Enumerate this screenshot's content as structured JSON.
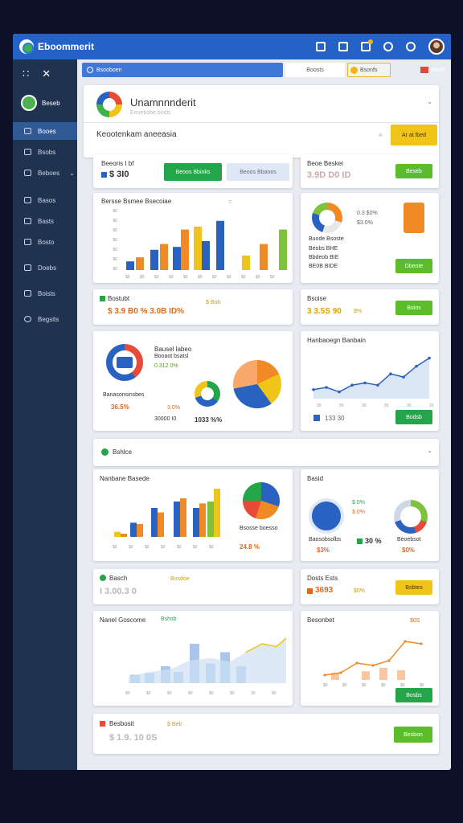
{
  "app": {
    "title": "Eboommerit"
  },
  "sidebar": {
    "user": "Beseb",
    "items": [
      {
        "label": "Booes"
      },
      {
        "label": "Bsobs"
      },
      {
        "label": "Beboes"
      },
      {
        "label": "Basos"
      },
      {
        "label": "Basts"
      },
      {
        "label": "Bosto"
      },
      {
        "label": "Doebs"
      },
      {
        "label": "Boists"
      },
      {
        "label": "Begsits"
      }
    ]
  },
  "search": {
    "placeholder": "Bsooboen",
    "btn1": "Boosts",
    "btn2": "Bsonfs",
    "read": "Banb"
  },
  "header": {
    "title": "Unamnnnderit",
    "subtitle": "Eeoebobe bodis",
    "section": "Keootenkam aneeasia",
    "action": "Ar at lbed"
  },
  "cards": {
    "c1": {
      "title": "Beeoris I bf",
      "value": "$ 3I0",
      "btn1": "Beoos Bbinks",
      "btn2": "Beoos Bbanos"
    },
    "c2": {
      "title": "Beoe Beskei",
      "value": "3.9D D0 ID",
      "btn": "Beseb"
    },
    "c3": {
      "title": "Bersse Bsmee Bsecoiae",
      "ticks": [
        "$0",
        "$0",
        "$0",
        "$0",
        "$0",
        "$0",
        "$0"
      ],
      "xl": [
        "$0",
        "$0",
        "$0",
        "$0",
        "$0",
        "$0",
        "$0",
        "$0",
        "$0",
        "$0",
        "$0"
      ]
    },
    "c4": {
      "legend": [
        "0.3 $0%",
        "$3.0%",
        "Buode Bsoste",
        "Beobs BHE",
        "Bbdeob BIE",
        "BE0B BIDE"
      ],
      "btn": "Dbeote"
    },
    "c5": {
      "title": "Bostubt",
      "value": "$ 3.9 B0 % 3.0B ID%",
      "tag": "$ Bob"
    },
    "c6": {
      "title": "Bsoise",
      "value": "3 3.5S 90",
      "tag": "$%",
      "btn": "Boios"
    },
    "c7": {
      "title": "Bausel labeo",
      "sub": "Booaot bsatsl",
      "pct": "0.312 0%",
      "cap": "Banasonsinsbes",
      "v1": "36.5%",
      "v2": "30000 I0",
      "v3": "1033 %%",
      "v4": "3.0%"
    },
    "c8": {
      "title": "Hanbaoegn Banbain",
      "value": "133 30",
      "btn": "Bodsb",
      "xl": [
        "30",
        "50",
        "30",
        "50",
        "30",
        "20"
      ]
    },
    "sec": {
      "title": "Bshlce"
    },
    "c9": {
      "title": "Nanbane Basede",
      "val": "24.8 %",
      "cap": "Bsosse boesso",
      "xl": [
        "$0",
        "$0",
        "$0",
        "$0",
        "$0",
        "$0",
        "$0"
      ]
    },
    "c10": {
      "title": "Basid",
      "b1": "$ 0%",
      "b2": "$ 0%",
      "v1": "$3%",
      "v2": "30 %",
      "v3": "$0%",
      "cap1": "Baosobsolbs",
      "cap2": "Beoebsot"
    },
    "c11": {
      "title": "Basch",
      "tag": "Bosdoe",
      "value": "I 3.00.3 0"
    },
    "c12": {
      "title": "Dosts Ests",
      "value": "3693",
      "tag": "$0%",
      "btn": "Bsbtes"
    },
    "c13": {
      "title": "Nanel Goscome",
      "tag": "Bshsb",
      "xl": [
        "$0",
        "$0",
        "$0",
        "$0",
        "$0",
        "$0",
        "30",
        "$0"
      ]
    },
    "c14": {
      "title": "Besonbet",
      "tag": "$0S",
      "xl": [
        "$0",
        "$0",
        "$0",
        "$0",
        "$0",
        "$0"
      ],
      "btn": "Bosbs"
    },
    "c15": {
      "title": "Besbosit",
      "value": "$ 1.9. 10 0S",
      "tag": "$ Beb",
      "btn": "Besbon"
    }
  },
  "colors": {
    "blue": "#2a62c2",
    "orange": "#f08a24",
    "yellow": "#f0c419",
    "green": "#7cc23a",
    "accent": "#2462c8"
  }
}
